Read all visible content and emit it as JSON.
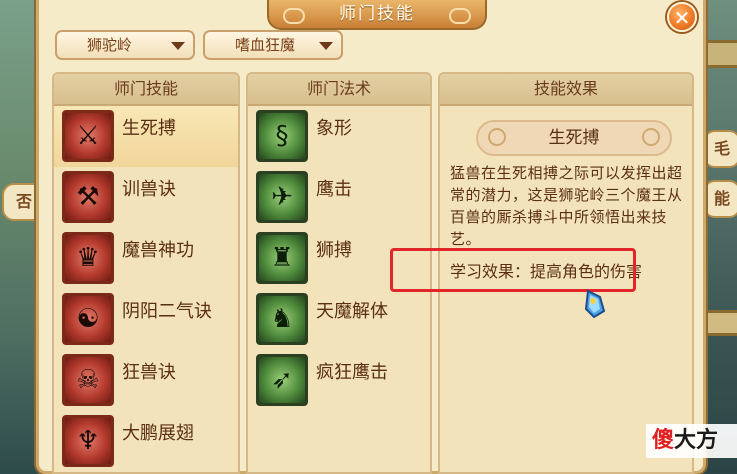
{
  "window": {
    "title": "师门技能",
    "close_glyph": "✕"
  },
  "filters": {
    "sect": "狮驼岭",
    "subsect": "嗜血狂魔"
  },
  "columns": {
    "skills_header": "师门技能",
    "spells_header": "师门法术",
    "effect_header": "技能效果"
  },
  "skills": [
    {
      "name": "生死搏",
      "icon": "sword-icon",
      "selected": true
    },
    {
      "name": "训兽诀",
      "icon": "whip-icon",
      "selected": false
    },
    {
      "name": "魔兽神功",
      "icon": "beast-mask-icon",
      "selected": false
    },
    {
      "name": "阴阳二气诀",
      "icon": "yin-yang-book-icon",
      "selected": false
    },
    {
      "name": "狂兽诀",
      "icon": "beast-skull-icon",
      "selected": false
    },
    {
      "name": "大鹏展翅",
      "icon": "wings-icon",
      "selected": false
    }
  ],
  "spells": [
    {
      "name": "象形",
      "icon": "elephant-icon"
    },
    {
      "name": "鹰击",
      "icon": "eagle-icon"
    },
    {
      "name": "狮搏",
      "icon": "lion-icon"
    },
    {
      "name": "天魔解体",
      "icon": "demon-icon"
    },
    {
      "name": "疯狂鹰击",
      "icon": "eagle-strike-icon"
    }
  ],
  "effect": {
    "skill_title": "生死搏",
    "description": "猛兽在生死相搏之际可以发挥出超常的潜力，这是狮驼岭三个魔王从百兽的厮杀搏斗中所领悟出来技艺。",
    "learn_effect": "学习效果：提高角色的伤害"
  },
  "background": {
    "bubble_left_1": "否",
    "bubble_right_1": "能",
    "bubble_right_2": "毛"
  },
  "watermark": {
    "part1": "傻",
    "part2": "大方"
  },
  "colors": {
    "window_bg": "#f6ebc9",
    "title_bar": "#d8964a",
    "highlight": "#e0262b",
    "text": "#5a2f14"
  }
}
